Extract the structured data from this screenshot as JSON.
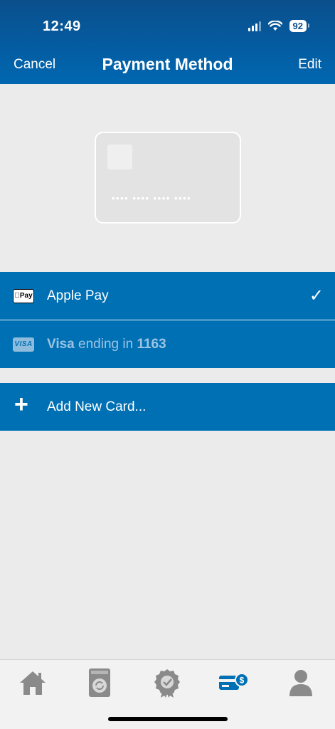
{
  "status_bar": {
    "time": "12:49",
    "battery": "92"
  },
  "nav": {
    "cancel_label": "Cancel",
    "title": "Payment Method",
    "edit_label": "Edit"
  },
  "card_preview": {
    "masked_number": "•••• •••• •••• ••••"
  },
  "payment_methods": [
    {
      "icon_text": "Pay",
      "label": "Apple Pay",
      "selected": true,
      "check": "✓"
    },
    {
      "icon_text": "VISA",
      "brand": "Visa",
      "ending_text": " ending in ",
      "last4": "1163",
      "selected": false
    }
  ],
  "add_card": {
    "icon": "+",
    "label": "Add New Card..."
  },
  "tabbar": {
    "items": [
      "home-icon",
      "laundry-machine-icon",
      "rewards-badge-icon",
      "payment-card-icon",
      "profile-icon"
    ],
    "active_index": 3
  },
  "colors": {
    "header": "#0067b1",
    "row": "#0070b5",
    "background": "#ebebeb",
    "tab_active": "#0070b5",
    "tab_inactive": "#8a8a8a"
  }
}
